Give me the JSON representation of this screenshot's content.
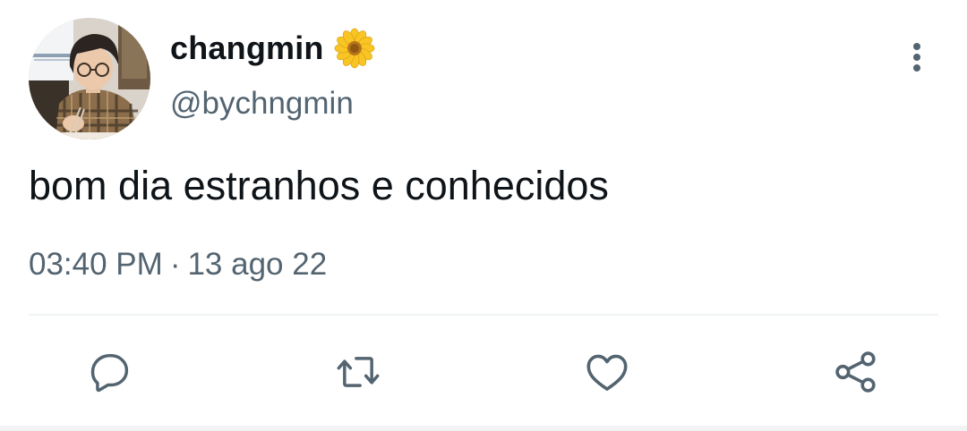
{
  "user": {
    "display_name": "changmin",
    "handle": "@bychngmin",
    "name_emoji": "sunflower-icon"
  },
  "tweet": {
    "text": "bom dia estranhos e conhecidos",
    "time": "03:40 PM",
    "separator": "·",
    "date": "13 ago 22"
  },
  "actions": [
    "reply-icon",
    "retweet-icon",
    "like-icon",
    "share-icon"
  ],
  "colors": {
    "text_primary": "#0f1419",
    "text_secondary": "#536471",
    "icon": "#536471",
    "divider": "#eff3f4",
    "sunflower_petal": "#f9c524",
    "sunflower_center": "#b8741a"
  }
}
